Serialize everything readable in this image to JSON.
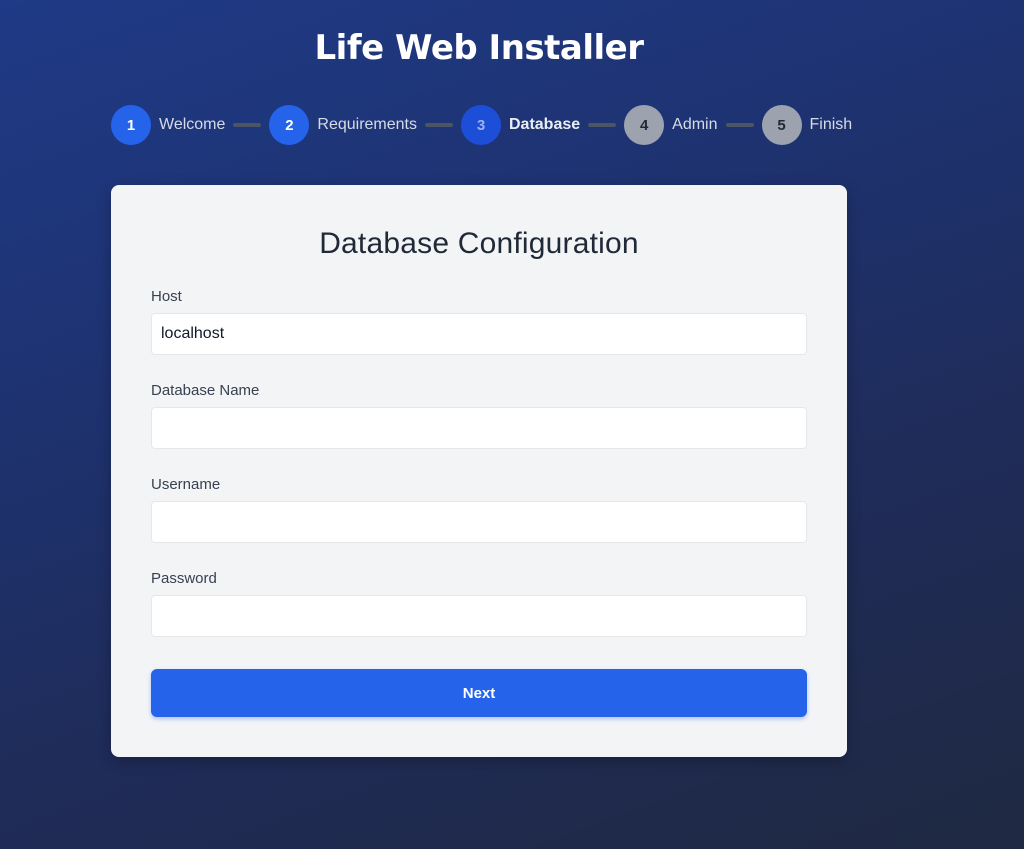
{
  "app": {
    "title": "Life Web Installer"
  },
  "stepper": {
    "steps": [
      {
        "number": "1",
        "label": "Welcome",
        "state": "done"
      },
      {
        "number": "2",
        "label": "Requirements",
        "state": "done"
      },
      {
        "number": "3",
        "label": "Database",
        "state": "active"
      },
      {
        "number": "4",
        "label": "Admin",
        "state": "pending"
      },
      {
        "number": "5",
        "label": "Finish",
        "state": "pending"
      }
    ]
  },
  "form": {
    "title": "Database Configuration",
    "fields": {
      "host": {
        "label": "Host",
        "value": "localhost"
      },
      "database_name": {
        "label": "Database Name",
        "value": ""
      },
      "username": {
        "label": "Username",
        "value": ""
      },
      "password": {
        "label": "Password",
        "value": ""
      }
    },
    "next_label": "Next"
  },
  "colors": {
    "accent": "#2563eb",
    "step_active": "#1d4ed8",
    "step_pending": "#9ca3af",
    "card_background": "#f3f4f6",
    "page_background": "#1e3270"
  }
}
